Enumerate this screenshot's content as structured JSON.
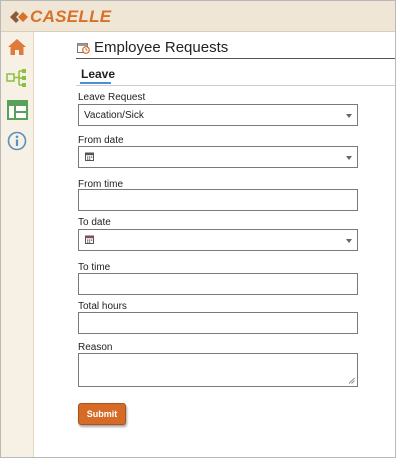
{
  "brand": {
    "name": "CASELLE",
    "color": "#d9712a"
  },
  "sidebar": {
    "items": [
      {
        "icon": "home-icon",
        "color": "#e07a3a"
      },
      {
        "icon": "hierarchy-icon",
        "color": "#8cbf3f"
      },
      {
        "icon": "layout-icon",
        "color": "#5aa05a"
      },
      {
        "icon": "info-icon",
        "color": "#5a8fc0"
      }
    ]
  },
  "page": {
    "title": "Employee Requests",
    "icon": "request-form-icon"
  },
  "tabs": [
    {
      "label": "Leave",
      "active": true
    }
  ],
  "form": {
    "leave_request": {
      "label": "Leave Request",
      "value": "Vacation/Sick"
    },
    "from_date": {
      "label": "From date",
      "value": ""
    },
    "from_time": {
      "label": "From time",
      "value": ""
    },
    "to_date": {
      "label": "To date",
      "value": ""
    },
    "to_time": {
      "label": "To time",
      "value": ""
    },
    "total_hours": {
      "label": "Total hours",
      "value": ""
    },
    "reason": {
      "label": "Reason",
      "value": ""
    },
    "submit_label": "Submit"
  },
  "colors": {
    "accent": "#d56b26",
    "tab_underline": "#4a90d9",
    "topbar": "#efe6d6",
    "sidebar": "#f6f1e4"
  }
}
